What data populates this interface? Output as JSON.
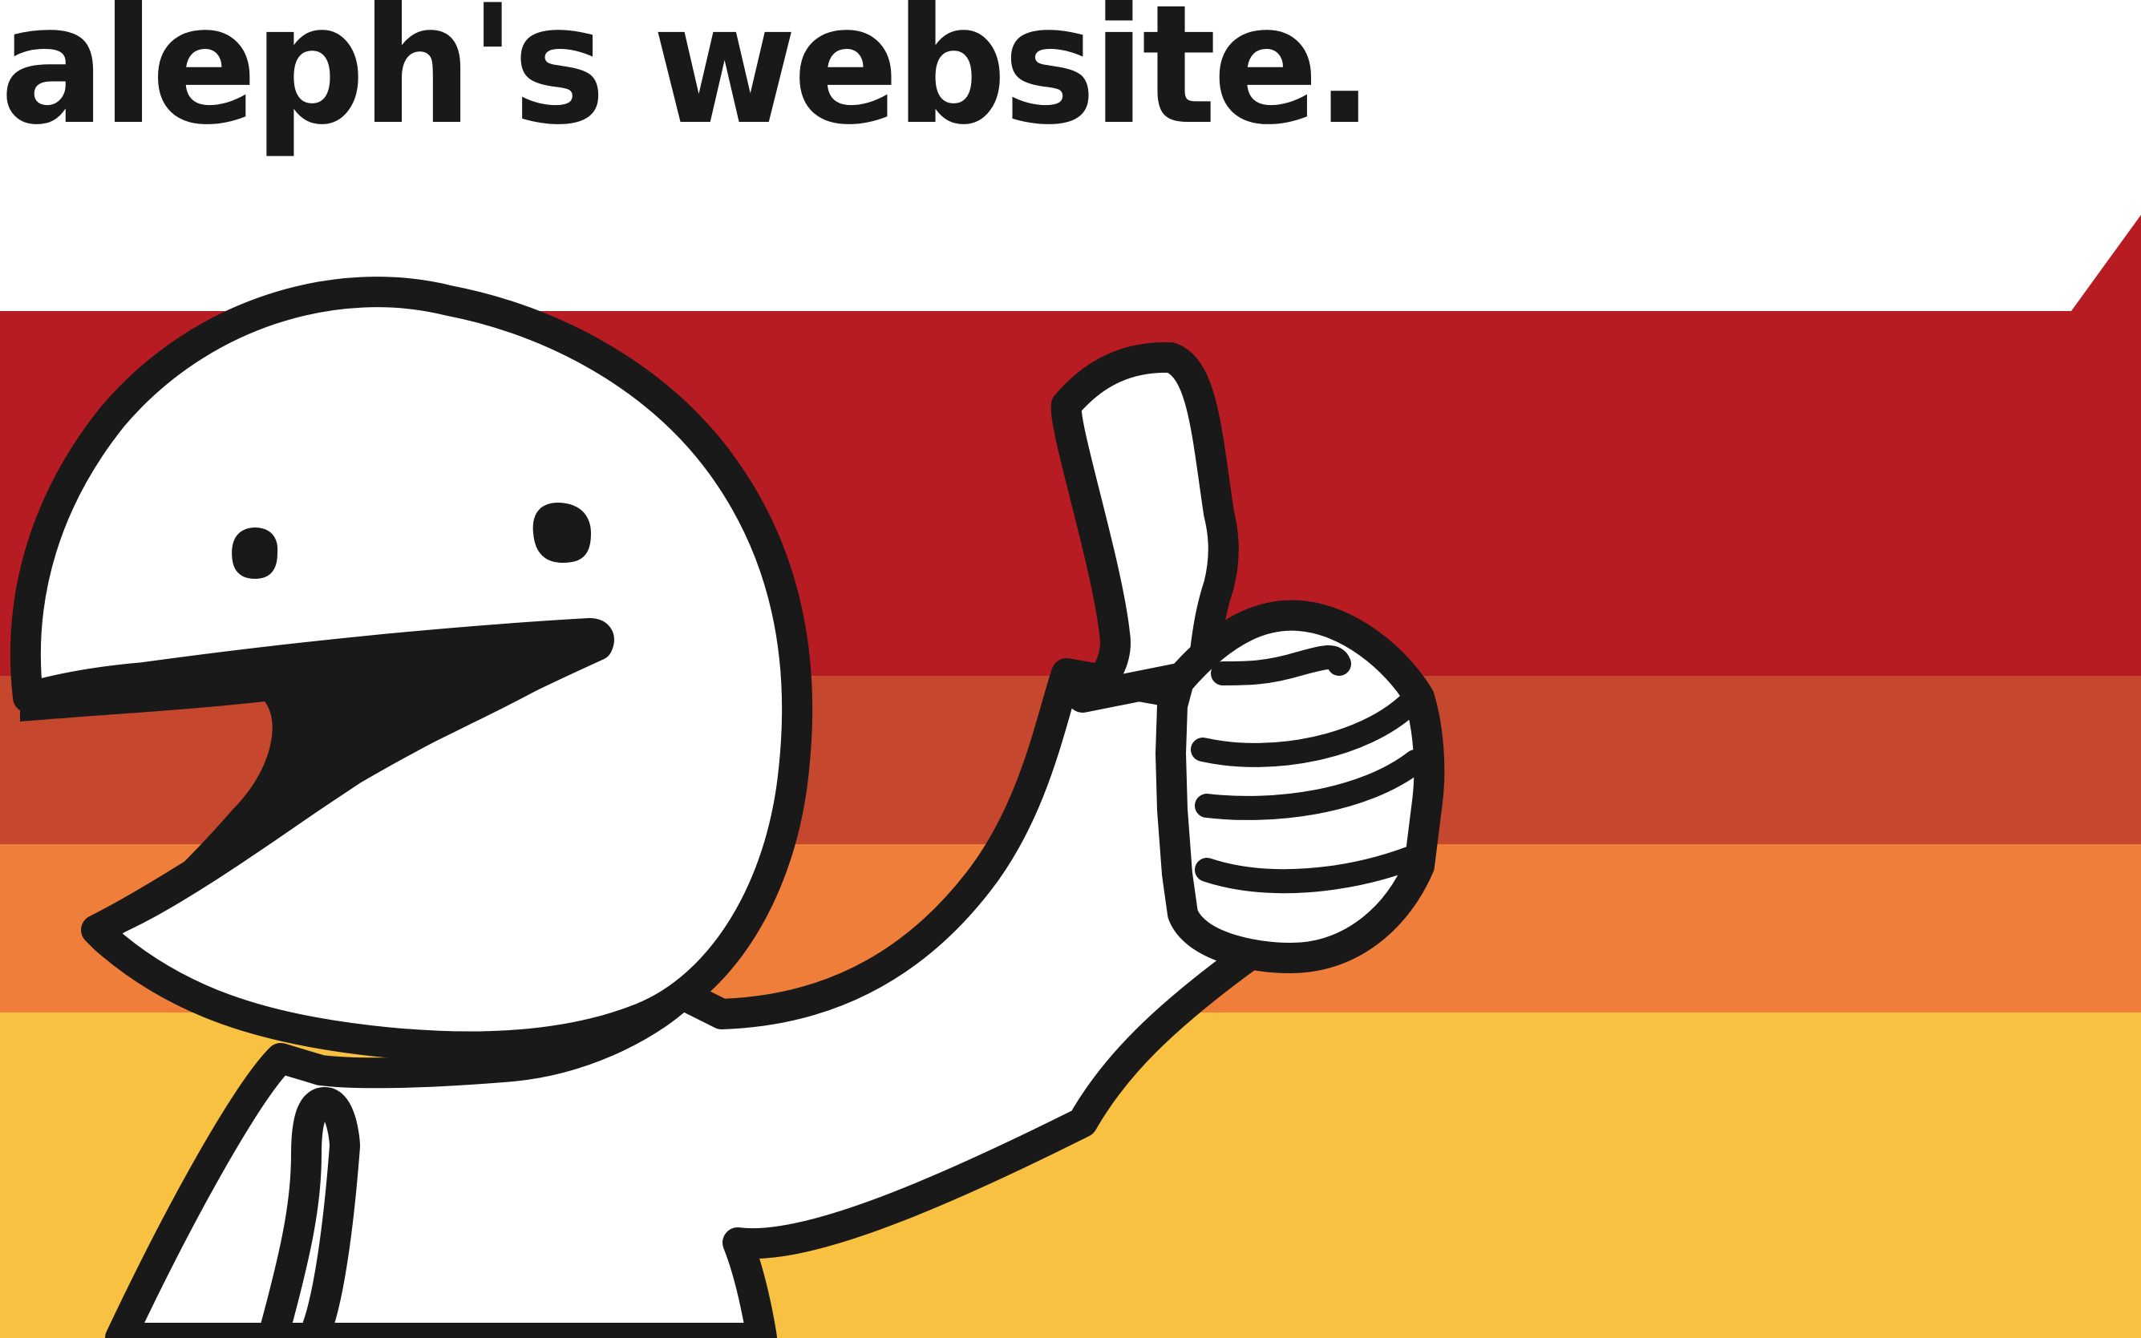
{
  "header": {
    "title": "aleph's website."
  },
  "colors": {
    "background": "#ffffff",
    "ink": "#1a1919",
    "stripe_red": "#b71c22",
    "stripe_rust": "#c4472e",
    "stripe_orange": "#ee7e3a",
    "stripe_yellow": "#f9c141",
    "figure_fill": "#ffffff"
  },
  "illustration": {
    "subject": "thumbs-up-character",
    "icons": [
      "thumbs-up-icon"
    ]
  }
}
